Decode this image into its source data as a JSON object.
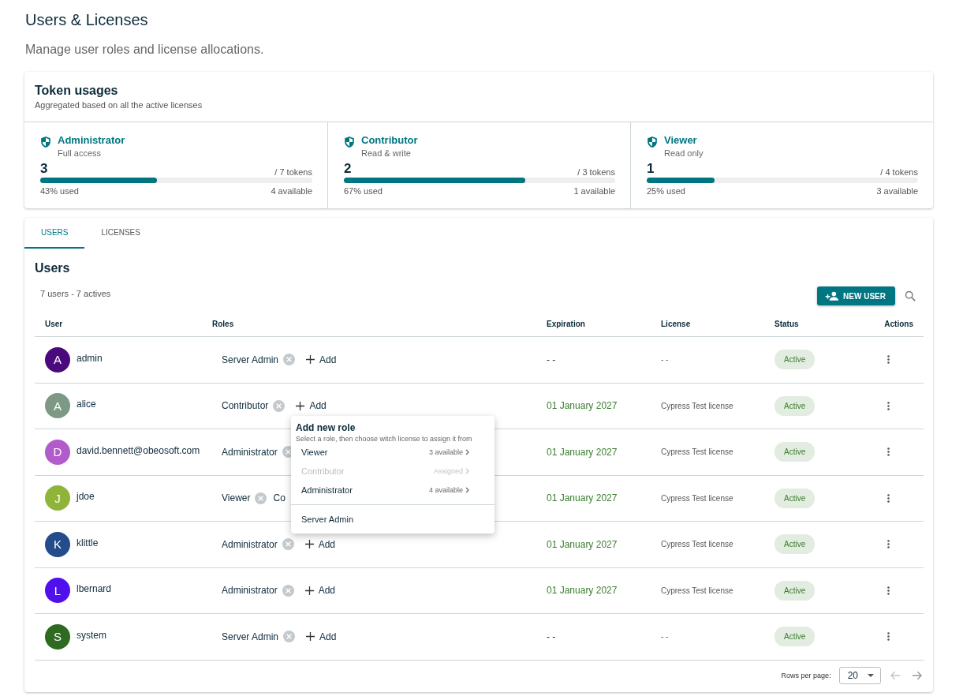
{
  "page": {
    "title": "Users & Licenses",
    "subtitle": "Manage user roles and license allocations."
  },
  "token_usage": {
    "title": "Token usages",
    "subtitle": "Aggregated based on all the active licenses",
    "roles": [
      {
        "name": "Administrator",
        "description": "Full access",
        "used": "3",
        "total": "/ 7 tokens",
        "level": 0.43,
        "used_label": "43% used",
        "available": "4 available"
      },
      {
        "name": "Contributor",
        "description": "Read & write",
        "used": "2",
        "total": "/ 3 tokens",
        "level": 0.67,
        "used_label": "67% used",
        "available": "1 available"
      },
      {
        "name": "Viewer",
        "description": "Read only",
        "used": "1",
        "total": "/ 4 tokens",
        "level": 0.25,
        "used_label": "25% used",
        "available": "3 available"
      }
    ]
  },
  "tabs": [
    {
      "label": "USERS",
      "selected": true
    },
    {
      "label": "LICENSES",
      "selected": false
    }
  ],
  "users": {
    "title": "Users",
    "count": "7 users - 7 actives",
    "new_button": "NEW USER",
    "columns": [
      "User",
      "Roles",
      "Expiration",
      "License",
      "Status",
      "Actions"
    ],
    "rows": [
      {
        "initial": "A",
        "color": "#4a0a7e",
        "name": "admin",
        "roles": [
          {
            "label": "Server Admin",
            "removable": true
          }
        ],
        "add": "Add",
        "dated": false,
        "expiration": "- -",
        "license": "- -",
        "status": "Active"
      },
      {
        "initial": "A",
        "color": "#7e9886",
        "name": "alice",
        "roles": [
          {
            "label": "Contributor",
            "removable": true
          }
        ],
        "add": "Add",
        "dated": true,
        "expiration": "01 January 2027",
        "license": "Cypress Test license",
        "status": "Active"
      },
      {
        "initial": "D",
        "color": "#b25ccc",
        "name": "david.bennett@obeosoft.com",
        "roles": [
          {
            "label": "Administrator",
            "removable": true
          }
        ],
        "dated": true,
        "expiration": "01 January 2027",
        "license": "Cypress Test license",
        "status": "Active"
      },
      {
        "initial": "J",
        "color": "#8fb43a",
        "name": "jdoe",
        "roles": [
          {
            "label": "Viewer",
            "removable": true
          },
          {
            "label": "Co",
            "removable": false
          }
        ],
        "dated": true,
        "expiration": "01 January 2027",
        "license": "Cypress Test license",
        "status": "Active"
      },
      {
        "initial": "K",
        "color": "#244b8a",
        "name": "klittle",
        "roles": [
          {
            "label": "Administrator",
            "removable": true
          }
        ],
        "add": "Add",
        "dated": true,
        "expiration": "01 January 2027",
        "license": "Cypress Test license",
        "status": "Active"
      },
      {
        "initial": "L",
        "color": "#5010ee",
        "name": "lbernard",
        "roles": [
          {
            "label": "Administrator",
            "removable": true
          }
        ],
        "add": "Add",
        "dated": true,
        "expiration": "01 January 2027",
        "license": "Cypress Test license",
        "status": "Active"
      },
      {
        "initial": "S",
        "color": "#2e6a1f",
        "name": "system",
        "roles": [
          {
            "label": "Server Admin",
            "removable": true
          }
        ],
        "add": "Add",
        "dated": false,
        "expiration": "- -",
        "license": "- -",
        "status": "Active"
      }
    ],
    "pagination": {
      "label": "Rows per page:",
      "value": "20"
    }
  },
  "add_role_menu": {
    "title": "Add new role",
    "subtitle": "Select a role, then choose witch license to assign it from",
    "items": [
      {
        "kind": "license",
        "label": "Viewer",
        "info": "3 available",
        "disabled": false
      },
      {
        "kind": "license",
        "label": "Contributor",
        "info": "Assigned",
        "disabled": true
      },
      {
        "kind": "license",
        "label": "Administrator",
        "info": "4 available",
        "disabled": false
      },
      {
        "kind": "plain",
        "label": "Server Admin",
        "disabled": false
      }
    ]
  }
}
